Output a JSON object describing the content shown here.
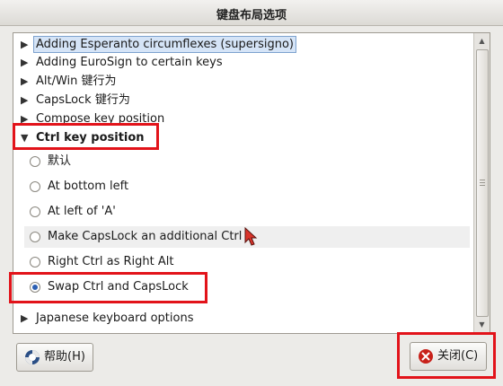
{
  "window": {
    "title": "键盘布局选项"
  },
  "options_list": {
    "groups_before": [
      {
        "label": "Adding Esperanto circumflexes (supersigno)",
        "selected": true
      },
      {
        "label": "Adding EuroSign to certain keys"
      },
      {
        "label": "Alt/Win 键行为"
      },
      {
        "label": "CapsLock 键行为"
      },
      {
        "label": "Compose key position"
      }
    ],
    "expanded_group": {
      "label": "Ctrl key position",
      "options": [
        {
          "label": "默认",
          "checked": false
        },
        {
          "label": "At bottom left",
          "checked": false
        },
        {
          "label": "At left of 'A'",
          "checked": false
        },
        {
          "label": "Make CapsLock an additional Ctrl",
          "checked": false,
          "hovered": true
        },
        {
          "label": "Right Ctrl as Right Alt",
          "checked": false
        },
        {
          "label": "Swap Ctrl and CapsLock",
          "checked": true
        }
      ]
    },
    "groups_after": [
      {
        "label": "Japanese keyboard options"
      }
    ]
  },
  "buttons": {
    "help": {
      "label": "帮助(H)",
      "icon": "help-lifebuoy-icon"
    },
    "close": {
      "label": "关闭(C)",
      "icon": "close-icon"
    }
  },
  "highlight_color": "#e2131a",
  "selection_color": "#d5e4f7"
}
